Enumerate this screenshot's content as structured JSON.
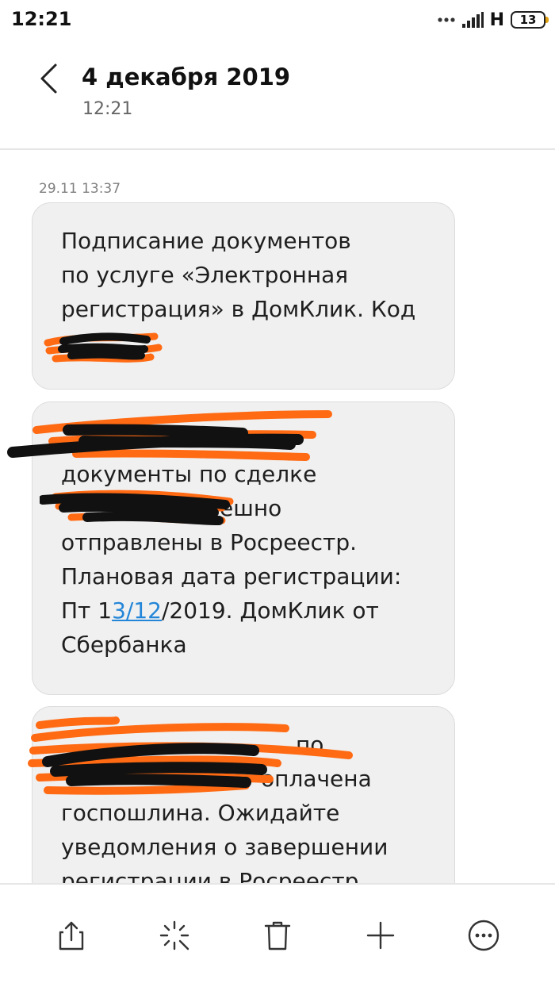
{
  "status_bar": {
    "time": "12:21",
    "network": "H",
    "battery": "13"
  },
  "header": {
    "title": "4 декабря 2019",
    "subtitle": "12:21"
  },
  "messages": [
    {
      "date": "29.11 13:37",
      "lines": [
        "Подписание документов",
        "по услуге «Электронная",
        "регистрация» в ДомКлик. Код -"
      ]
    },
    {
      "lines": [
        "документы по сделке",
        "ешно",
        "отправлены в Росреестр.",
        "Плановая дата регистрации:",
        "Пт 1",
        "3/12",
        "/2019. ДомКлик от",
        "Сбербанка"
      ]
    },
    {
      "lines": [
        "по",
        "оплачена",
        "госпошлина. Ожидайте",
        "уведомления о завершении",
        "регистрации в Росреестр"
      ]
    }
  ],
  "colors": {
    "bubble": "#f0f0f0",
    "link": "#2486d8",
    "redact_orange": "#ff6a13",
    "redact_black": "#111111"
  },
  "toolbar": {
    "icons": [
      "share-icon",
      "sparkle-icon",
      "trash-icon",
      "plus-icon",
      "more-icon"
    ]
  }
}
